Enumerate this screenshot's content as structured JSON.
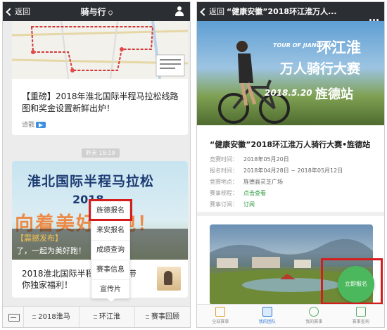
{
  "left": {
    "nav": {
      "back": "返回",
      "title": "骑与行"
    },
    "card1": {
      "title": "【重磅】2018年淮北国际半程马拉松线路图和奖金设置新鲜出炉！",
      "read_more": "请戳"
    },
    "timestamp": "昨天 18:19",
    "card2": {
      "banner_title": "淮北国际半程马拉松",
      "banner_year": "2018",
      "banner_slogan": "向着美好奔跑！",
      "overlay_tag": "【震撼发布】",
      "overlay_line2": "了，一起为美好跑！",
      "title": "2018淮北国际半程马拉松，带你独家福利！"
    },
    "popup": {
      "items": [
        "旌德报名",
        "来安报名",
        "成绩查询",
        "赛事信息",
        "宣传片"
      ]
    },
    "menubar": {
      "items": [
        "2018淮马",
        "环江淮",
        "赛事回顾"
      ]
    }
  },
  "right": {
    "nav": {
      "back": "返回",
      "title": "“健康安徽”2018环江淮万人..."
    },
    "hero": {
      "subtitle": "TOUR OF JIANGHUAI",
      "title_a": "环江淮",
      "title_b": "万人骑行大赛",
      "date": "2018.5.20",
      "station": "旌德站"
    },
    "event_title": "“健康安徽”2018环江淮万人骑行大赛•旌德站",
    "info": [
      {
        "label": "竞赛时间：",
        "value": "2018年05月20日",
        "green": false
      },
      {
        "label": "报名时间：",
        "value": "2018年04月28日 ~ 2018年05月12日",
        "green": false
      },
      {
        "label": "竞赛地点：",
        "value": "旌德县灵芝广场",
        "green": false
      },
      {
        "label": "赛事规程：",
        "value": "点击查看",
        "green": true
      },
      {
        "label": "赛事订阅：",
        "value": "订阅",
        "green": true
      }
    ],
    "apply_button": "立即报名",
    "tabs": [
      "全部赛事",
      "我的团队",
      "我的赛事",
      "赛事查询"
    ]
  },
  "colors": {
    "nav_bg": "#2b2f33",
    "highlight_red": "#d41e1e",
    "apply_green": "#4cb85d",
    "link_green": "#2e9a3c"
  }
}
